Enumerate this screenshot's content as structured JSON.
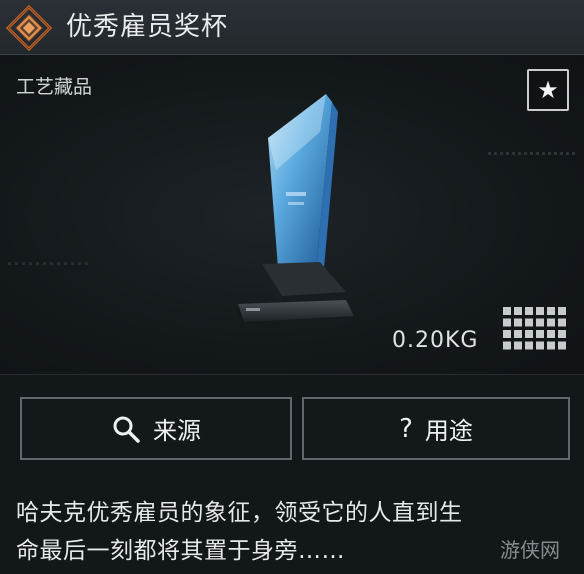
{
  "header": {
    "title": "优秀雇员奖杯",
    "logo_icon": "diamond-emblem-icon",
    "accent_color": "#c8692f"
  },
  "item": {
    "category": "工艺藏品",
    "favorite_icon": "star-icon",
    "favorite_glyph": "★",
    "weight": "0.20KG",
    "size_icon": "inventory-grid-icon",
    "grid_cells": {
      "cols": 6,
      "rows": 4
    }
  },
  "actions": {
    "source_label": "来源",
    "source_icon": "search-icon",
    "source_glyph": "🔍",
    "use_label": "用途",
    "use_icon": "question-icon",
    "use_glyph": "?"
  },
  "description": {
    "line1": "哈夫克优秀雇员的象征，领受它的人直到生",
    "line2": "命最后一刻都将其置于身旁……"
  },
  "watermark": "游侠网"
}
